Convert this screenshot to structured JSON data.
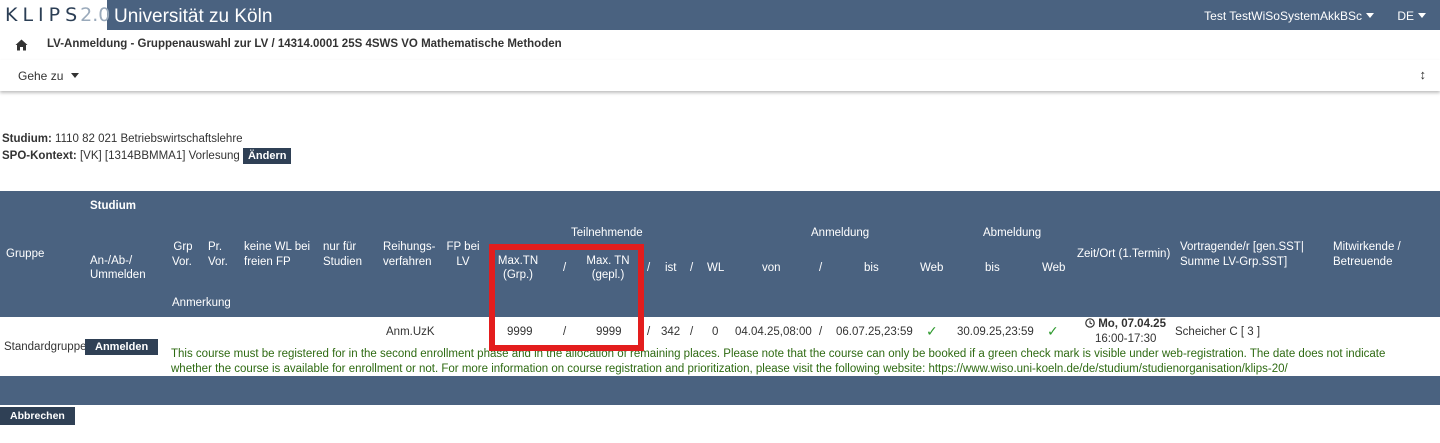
{
  "header": {
    "logo_text": "KLIPS",
    "logo_version": "2.0",
    "university": "Universität zu Köln",
    "user": "Test TestWiSoSystemAkkBSc",
    "language": "DE"
  },
  "breadcrumb": {
    "icon": "home-icon",
    "text": "LV-Anmeldung - Gruppenauswahl zur LV / 14314.0001 25S 4SWS VO Mathematische Methoden"
  },
  "toolbar": {
    "goto_label": "Gehe zu",
    "expand_icon": "↕"
  },
  "studium": {
    "label": "Studium:",
    "value": "1110 82 021 Betriebswirtschaftslehre",
    "spo_label": "SPO-Kontext:",
    "spo_value": "[VK] [1314BBMMA1] Vorlesung",
    "change_button": "Ändern"
  },
  "table_header": {
    "gruppe": "Gruppe",
    "studium": "Studium",
    "an_ab": "An-/Ab-/",
    "ummelden": "Ummelden",
    "grp": "Grp",
    "vor1": "Vor.",
    "pr": "Pr.",
    "vor2": "Vor.",
    "keine_wl": "keine WL bei",
    "freien_fp": "freien FP",
    "nur_fuer": "nur für",
    "studien": "Studien",
    "reihungs": "Reihungs-",
    "verfahren": "verfahren",
    "fp_bei": "FP bei",
    "lv": "LV",
    "teilnehmende": "Teilnehmende",
    "max_tn": "Max.TN",
    "grp_paren": "(Grp.)",
    "max_tn2": "Max. TN",
    "gepl": "(gepl.)",
    "slash": "/",
    "ist": "ist",
    "wl": "WL",
    "anmeldung": "Anmeldung",
    "von": "von",
    "bis": "bis",
    "web": "Web",
    "abmeldung": "Abmeldung",
    "zeit_ort": "Zeit/Ort (1.Termin)",
    "vortragende1": "Vortragende/r [gen.SST|",
    "vortragende2": "Summe LV-Grp.SST]",
    "mitwirkende1": "Mitwirkende /",
    "mitwirkende2": "Betreuende",
    "anmerkung": "Anmerkung"
  },
  "row": {
    "gruppe": "Standardgruppe",
    "register_button": "Anmelden",
    "reihung": "Anm.UzK",
    "max_tn_grp": "9999",
    "max_tn_gepl": "9999",
    "ist": "342",
    "wl": "0",
    "anm_von": "04.04.25,08:00",
    "anm_bis": "06.07.25,23:59",
    "abm_bis": "30.09.25,23:59",
    "termin_day": "Mo, 07.04.25",
    "termin_time": "16:00-17:30",
    "vortragende": "Scheicher C [ 3 ]",
    "note": "This course must be registered for in the second enrollment phase and in the allocation of remaining places. Please note that the course can only be booked if a green check mark is visible under web-registration. The date does not indicate whether the course is available for enrollment or not. For more information on course registration and prioritization, please visit the following website: https://www.wiso.uni-koeln.de/de/studium/studienorganisation/klips-20/"
  },
  "footer": {
    "cancel_button": "Abbrechen"
  },
  "colors": {
    "header_bg": "#4a6280",
    "button_bg": "#2f4055",
    "highlight": "#e31d1d",
    "note_green": "#2e6a12"
  }
}
